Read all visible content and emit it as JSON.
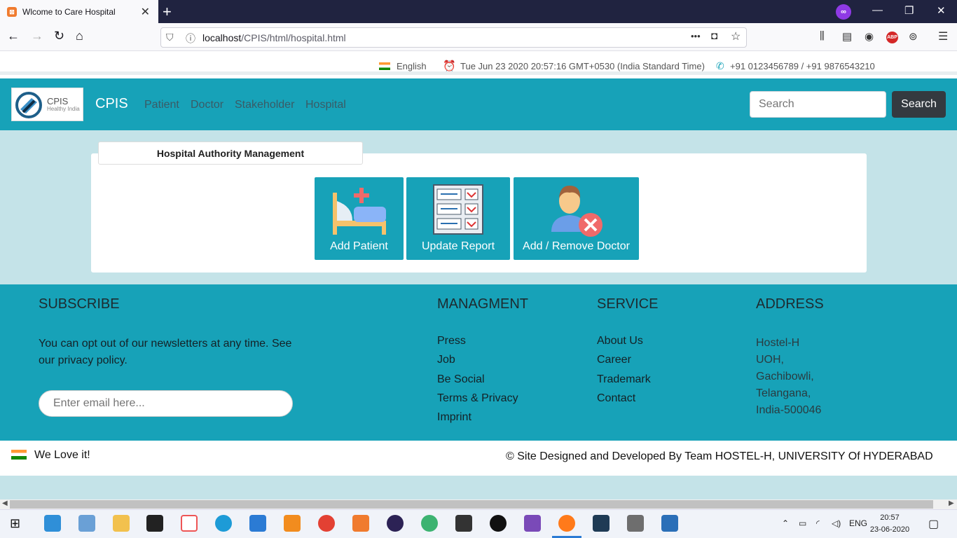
{
  "browser": {
    "tab_title": "Wlcome to Care Hospital",
    "url_host": "localhost",
    "url_path": "/CPIS/html/hospital.html",
    "new_tab": "+",
    "menu_dots": "•••"
  },
  "info_strip": {
    "language": "English",
    "datetime": "Tue Jun 23 2020 20:57:16 GMT+0530 (India Standard Time)",
    "phone": "+91 0123456789 / +91 9876543210"
  },
  "navbar": {
    "logo_text": "CPIS",
    "logo_sub": "Healthy India",
    "brand": "CPIS",
    "links": [
      "Patient",
      "Doctor",
      "Stakeholder",
      "Hospital"
    ],
    "search_placeholder": "Search",
    "search_button": "Search"
  },
  "main": {
    "card_title": "Hospital Authority Management",
    "tiles": [
      "Add Patient",
      "Update Report",
      "Add / Remove Doctor"
    ]
  },
  "footer": {
    "subscribe_title": "SUBSCRIBE",
    "subscribe_text": "You can opt out of our newsletters at any time. See our privacy policy.",
    "email_placeholder": "Enter email here...",
    "management_title": "MANAGMENT",
    "management_links": [
      "Press",
      "Job",
      "Be Social",
      "Terms & Privacy",
      "Imprint"
    ],
    "service_title": "SERVICE",
    "service_links": [
      "About Us",
      "Career",
      "Trademark",
      "Contact"
    ],
    "address_title": "ADDRESS",
    "address_lines": [
      "Hostel-H",
      "UOH,",
      "Gachibowli,",
      "Telangana,",
      "India-500046"
    ]
  },
  "bottom": {
    "love": "We Love it!",
    "copyright": "© Site Designed and Developed By Team HOSTEL-H, UNIVERSITY Of HYDERABAD"
  },
  "taskbar": {
    "lang": "ENG",
    "time": "20:57",
    "date": "23-06-2020"
  },
  "colors": {
    "accent": "#17a2b8",
    "page_bg": "#c4e3e8",
    "dark_button": "#343a40"
  }
}
